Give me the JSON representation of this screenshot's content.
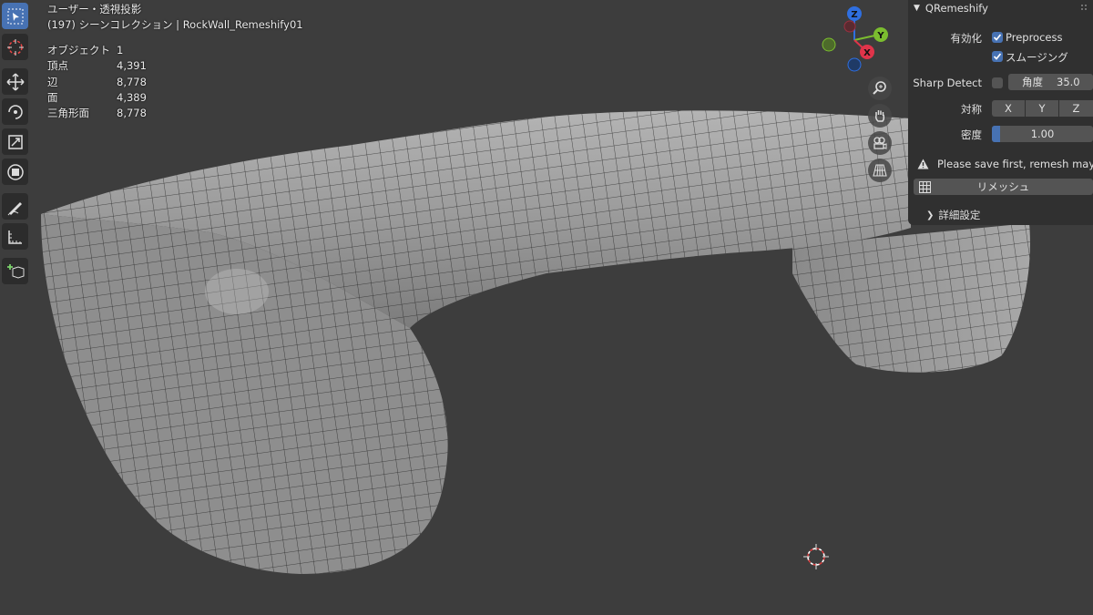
{
  "viewport": {
    "view_name": "ユーザー・透視投影",
    "collection_line": "(197) シーンコレクション | RockWall_Remeshify01",
    "stats": [
      {
        "label": "オブジェクト",
        "value": "1"
      },
      {
        "label": "頂点",
        "value": "4,391"
      },
      {
        "label": "辺",
        "value": "8,778"
      },
      {
        "label": "面",
        "value": "4,389"
      },
      {
        "label": "三角形面",
        "value": "8,778"
      }
    ],
    "background_color": "#3d3d3d"
  },
  "toolbar": {
    "tools": [
      {
        "name": "select-box-tool",
        "icon": "select-box-icon",
        "active": true
      },
      {
        "name": "cursor-tool",
        "icon": "cursor-icon",
        "active": false
      },
      {
        "name": "move-tool",
        "icon": "move-icon",
        "active": false
      },
      {
        "name": "rotate-tool",
        "icon": "rotate-icon",
        "active": false
      },
      {
        "name": "scale-tool",
        "icon": "scale-icon",
        "active": false
      },
      {
        "name": "transform-tool",
        "icon": "transform-icon",
        "active": false
      },
      {
        "name": "annotate-tool",
        "icon": "annotate-icon",
        "active": false
      },
      {
        "name": "measure-tool",
        "icon": "measure-icon",
        "active": false
      },
      {
        "name": "add-cube-tool",
        "icon": "add-cube-icon",
        "active": false
      }
    ]
  },
  "gizmo": {
    "axes": [
      {
        "label": "Z",
        "color": "#2f6fe0"
      },
      {
        "label": "Y",
        "color": "#7bbd2f"
      },
      {
        "label": "X",
        "color": "#e0344a"
      }
    ]
  },
  "nav_buttons": [
    "zoom-icon",
    "pan-hand-icon",
    "camera-icon",
    "perspective-grid-icon"
  ],
  "panel": {
    "title": "QRemeshify",
    "enable_label": "有効化",
    "preprocess_label": "Preprocess",
    "preprocess_checked": true,
    "smoothing_label": "スムージング",
    "smoothing_checked": true,
    "sharp_detect_label": "Sharp Detect",
    "sharp_detect_checked": false,
    "angle_label": "角度",
    "angle_value": "35.0",
    "symmetry_label": "対称",
    "symmetry_axes": [
      "X",
      "Y",
      "Z"
    ],
    "density_label": "密度",
    "density_value": "1.00",
    "warning_text": "Please save first, remesh may b...",
    "remesh_label": "リメッシュ",
    "advanced_label": "詳細設定",
    "accent_color": "#4772b3"
  }
}
